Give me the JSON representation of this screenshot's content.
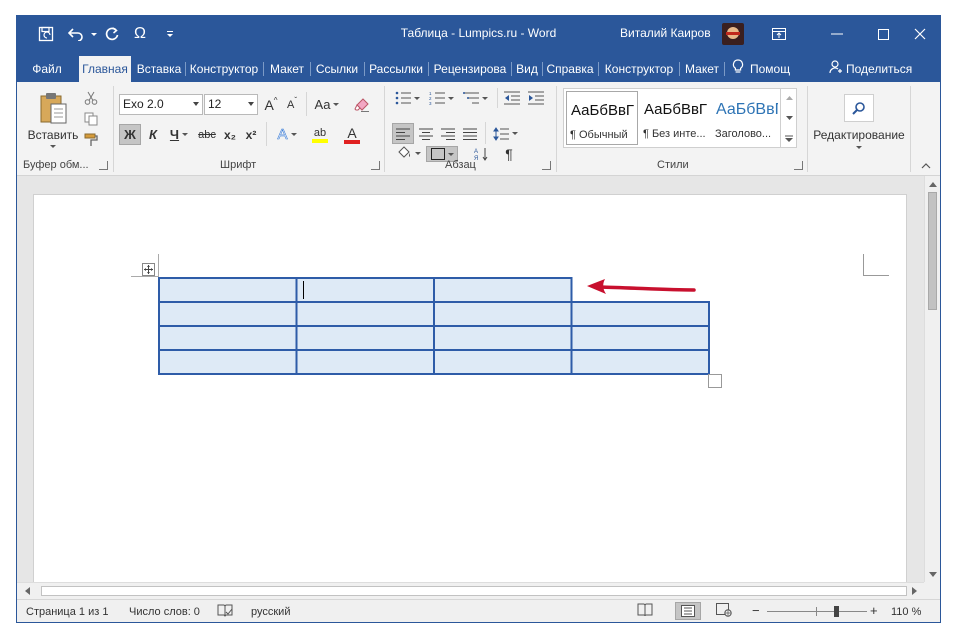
{
  "window": {
    "title": "Таблица - Lumpics.ru  -  Word",
    "user_name": "Виталий Каиров",
    "qat": {
      "save_icon": "save-icon",
      "undo_icon": "undo-icon",
      "redo_icon": "redo-icon",
      "symbol_label": "Ω",
      "customize_icon": "customize-qat-icon"
    },
    "controls": {
      "ribbon_options_icon": "ribbon-display-options-icon",
      "minimize_icon": "minimize-icon",
      "maximize_icon": "maximize-icon",
      "close_icon": "close-icon"
    }
  },
  "tabs": [
    {
      "label": "Файл",
      "active": false
    },
    {
      "label": "Главная",
      "active": true
    },
    {
      "label": "Вставка",
      "active": false
    },
    {
      "label": "Конструктор",
      "active": false
    },
    {
      "label": "Макет",
      "active": false
    },
    {
      "label": "Ссылки",
      "active": false
    },
    {
      "label": "Рассылки",
      "active": false
    },
    {
      "label": "Рецензирова",
      "active": false
    },
    {
      "label": "Вид",
      "active": false
    },
    {
      "label": "Справка",
      "active": false
    },
    {
      "label": "Конструктор",
      "active": false
    },
    {
      "label": "Макет",
      "active": false
    }
  ],
  "tell_me": {
    "label": "Помощ",
    "icon": "lightbulb-icon"
  },
  "share": {
    "label": "Поделиться",
    "icon": "share-person-icon"
  },
  "ribbon": {
    "clipboard": {
      "label": "Буфер обм...",
      "paste_label": "Вставить",
      "cut_icon": "scissors-icon",
      "copy_icon": "copy-icon",
      "format_painter_icon": "format-painter-icon"
    },
    "font": {
      "label": "Шрифт",
      "font_name": "Exo 2.0",
      "font_size": "12",
      "grow_label": "A",
      "shrink_label": "A",
      "case_label": "Aa",
      "bold_label": "Ж",
      "italic_label": "К",
      "underline_label": "Ч",
      "strike_label": "abc",
      "subscript_label": "x₂",
      "superscript_label": "x²",
      "effects_label": "A",
      "highlight_label": "ab",
      "color_label": "A",
      "highlight_color": "#ffff00",
      "font_color": "#e02020"
    },
    "paragraph": {
      "label": "Абзац",
      "pilcrow": "¶"
    },
    "styles": {
      "label": "Стили",
      "items": [
        {
          "sample": "АаБбВвГ",
          "name": "¶ Обычный"
        },
        {
          "sample": "АаБбВвГ",
          "name": "¶ Без инте..."
        },
        {
          "sample": "АаБбВвГ",
          "name": "Заголово..."
        }
      ],
      "heading_color": "#2e74b5"
    },
    "editing": {
      "label": "Редактирование",
      "icon": "search-icon"
    }
  },
  "document": {
    "table": {
      "rows": 4,
      "fill": "#deeaf6",
      "border": "#2e5ca8",
      "first_row_columns": 3,
      "columns": 4
    },
    "arrow_color": "#c8102e"
  },
  "status": {
    "page": "Страница 1 из 1",
    "words": "Число слов: 0",
    "language": "русский",
    "zoom": "110 %",
    "zoom_minus": "−",
    "zoom_plus": "+",
    "zoom_value": 110
  }
}
